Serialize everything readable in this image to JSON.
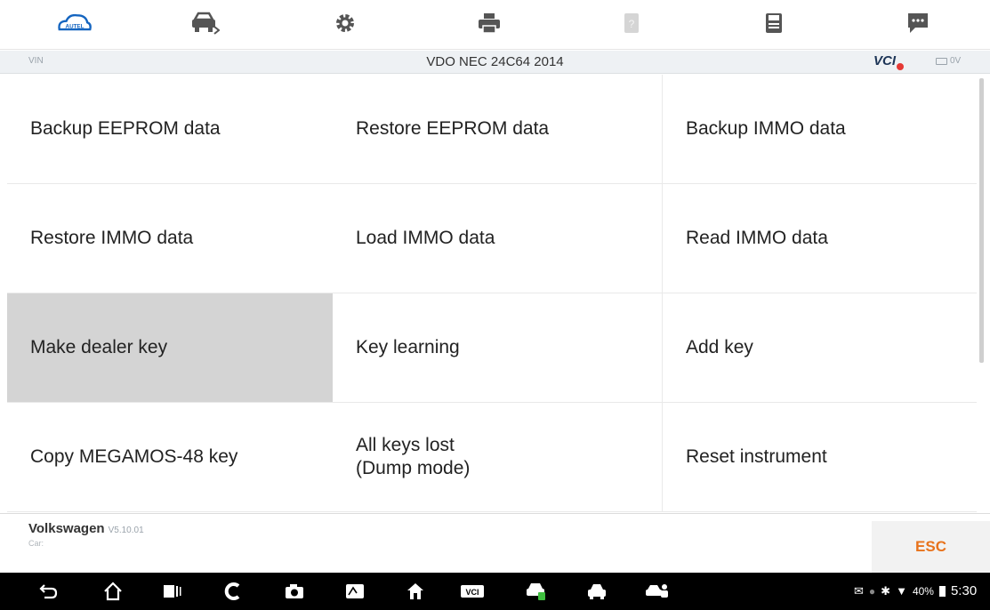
{
  "toolbar": {
    "icons": [
      "autel-home-icon",
      "vehicle-swap-icon",
      "settings-gear-icon",
      "print-icon",
      "help-icon",
      "save-icon",
      "message-icon"
    ],
    "logo_text": "AUTEL"
  },
  "infobar": {
    "vin_label": "VIN",
    "title": "VDO NEC 24C64 2014",
    "vci_label": "VCI",
    "voltage": "0V"
  },
  "menu": {
    "items": [
      "Backup EEPROM data",
      "Restore EEPROM data",
      "Backup IMMO data",
      "Restore IMMO data",
      "Load IMMO data",
      "Read IMMO data",
      "Make dealer key",
      "Key learning",
      "Add key",
      "Copy MEGAMOS-48 key",
      "All keys lost\n(Dump mode)",
      "Reset instrument"
    ],
    "selected_index": 6
  },
  "footer": {
    "make": "Volkswagen",
    "version": "V5.10.01",
    "sub": "Car:",
    "esc_label": "ESC"
  },
  "navbar": {
    "battery": "40%",
    "time": "5:30"
  },
  "colors": {
    "accent_orange": "#e8731c",
    "selected_row": "#d4d4d4",
    "autel_blue": "#1565c0"
  }
}
